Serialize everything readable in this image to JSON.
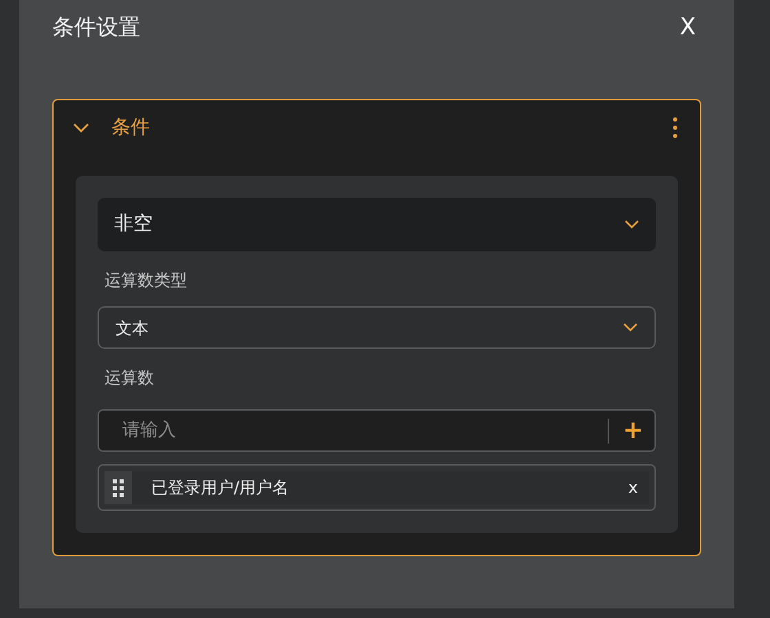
{
  "dialog": {
    "title": "条件设置",
    "close": "X"
  },
  "condition": {
    "title": "条件",
    "expanded": true,
    "operator": {
      "value": "非空"
    },
    "operand_type": {
      "label": "运算数类型",
      "value": "文本"
    },
    "operand": {
      "label": "运算数",
      "placeholder": "请输入",
      "add": "+",
      "tags": [
        {
          "text": "已登录用户/用户名",
          "remove": "x"
        }
      ]
    }
  }
}
